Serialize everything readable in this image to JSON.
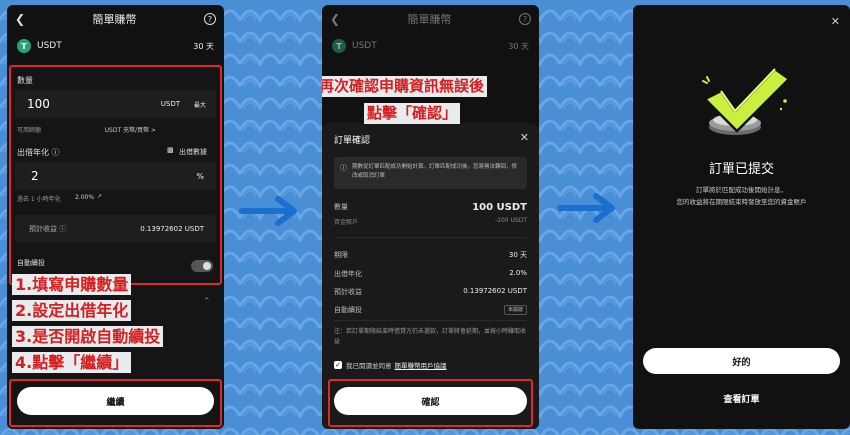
{
  "screen1": {
    "back_icon": "chevron-left-icon",
    "title": "簡單賺幣",
    "help_label": "?",
    "coin_name": "USDT",
    "term": "30 天",
    "quantity_label": "數量",
    "quantity_value": "100",
    "quantity_unit": "USDT",
    "max_label": "最大",
    "available_label": "可用餘額",
    "available_value": "USDT 充幣/買幣 >",
    "rate_label": "出借年化 ⓘ",
    "rate_data_label": "出借數據",
    "rate_value": "2",
    "rate_unit": "%",
    "recent_rate_label": "過去 1 小時年化",
    "recent_rate_value": "2.00%",
    "estimate_label": "預計收益 ⓘ",
    "estimate_value": "0.13972602 USDT",
    "auto_label": "自動續投",
    "continue_label": "繼續"
  },
  "screen1_annotations": [
    "1.填寫申購數量",
    "2.設定出借年化",
    "3.是否開啟自動續投",
    "4.點擊「繼續」"
  ],
  "screen2": {
    "annotation_line1": "再次確認申購資訊無誤後",
    "annotation_line2": "點擊「確認」",
    "back_icon": "chevron-left-icon",
    "title": "簡單賺幣",
    "help_label": "?",
    "coin_name": "USDT",
    "term": "30 天",
    "sheet_title": "訂單確認",
    "notice": "期數從訂單匹配成功開始計算。訂單匹配成功後，您將無法轉回，修改或取消訂單",
    "amount_label": "數量",
    "amount_value": "100 USDT",
    "account_label": "資金賬戶",
    "account_value": "-100 USDT",
    "period_label": "期限",
    "period_value": "30 天",
    "rate_label": "出借年化",
    "rate_value": "2.0%",
    "estimate_label": "預計收益",
    "estimate_value": "0.13972602 USDT",
    "auto_label": "自動續投",
    "auto_value": "未開啟",
    "note": "注：若訂單期限結束時借貸方仍未還款，訂單將會延期，並按小時賺取收益",
    "agree_prefix": "我已閱讀並同意",
    "agree_link": "簡單賺幣用戶協議",
    "confirm_label": "確認"
  },
  "screen3": {
    "close_icon": "close-icon",
    "title": "訂單已提交",
    "desc_line1": "訂單將於匹配成功後開始計息，",
    "desc_line2": "您的收益將在期限結束時發放至您的資金賬戶",
    "ok_label": "好的",
    "view_label": "查看訂單"
  },
  "colors": {
    "background": "#4a8fd6",
    "annotation_red": "#d81e1e",
    "check_green": "#c8f03c",
    "arrow_blue": "#1a6fd0"
  }
}
